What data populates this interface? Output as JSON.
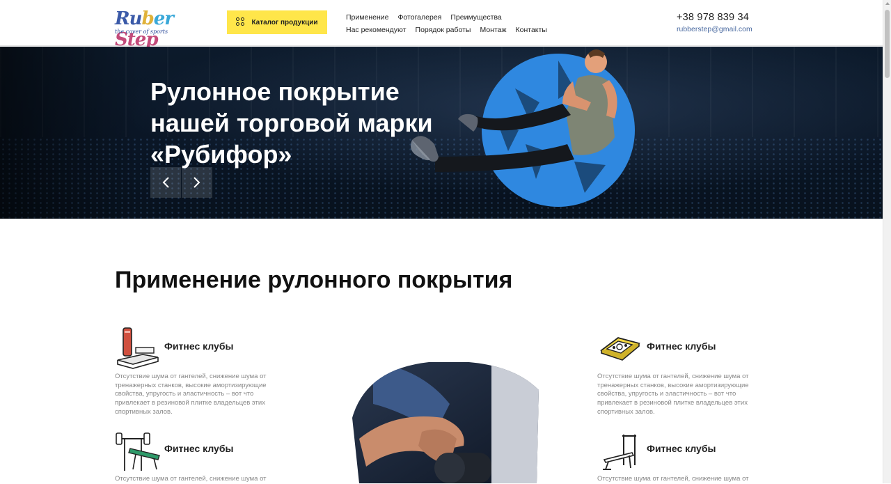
{
  "header": {
    "logo": {
      "word_parts": [
        "Ru",
        "b",
        "er ",
        "Step"
      ],
      "tagline": "the cover of sports"
    },
    "catalog_button": {
      "label": "Каталог продукции",
      "icon": "grid-circles-icon",
      "color": "#ffe64a"
    },
    "nav_row1": [
      "Применение",
      "Фотогалерея",
      "Преимущества"
    ],
    "nav_row2": [
      "Нас рекомендуют",
      "Порядок работы",
      "Монтаж",
      "Контакты"
    ],
    "phone": "+38 978 839 34",
    "email": "rubberstep@gmail.com"
  },
  "hero": {
    "title_lines": [
      "Рулонное покрытие",
      "нашей торговой марки",
      "«Рубифор»"
    ],
    "prev_icon": "chevron-left-icon",
    "next_icon": "chevron-right-icon",
    "accent_color": "#2f88e0"
  },
  "section": {
    "title": "Применение рулонного покрытия",
    "features": [
      {
        "title": "Фитнес клубы",
        "icon": "step-platform-icon",
        "text": "Отсутствие шума от гантелей, снижение шума от тренажерных станков, высокие амортизирующие свойства, упругость и эластичность – вот что привлекает в резиновой плитке владельцев этих спортивных залов."
      },
      {
        "title": "Фитнес клубы",
        "icon": "weight-plate-tile-icon",
        "text": "Отсутствие шума от гантелей, снижение шума от тренажерных станков, высокие амортизирующие свойства, упругость и эластичность – вот что привлекает в резиновой плитке владельцев этих спортивных залов."
      },
      {
        "title": "Фитнес клубы",
        "icon": "bench-press-icon",
        "text": "Отсутствие шума от гантелей, снижение шума от"
      },
      {
        "title": "Фитнес клубы",
        "icon": "weight-bench-icon",
        "text": "Отсутствие шума от гантелей, снижение шума от"
      }
    ]
  }
}
